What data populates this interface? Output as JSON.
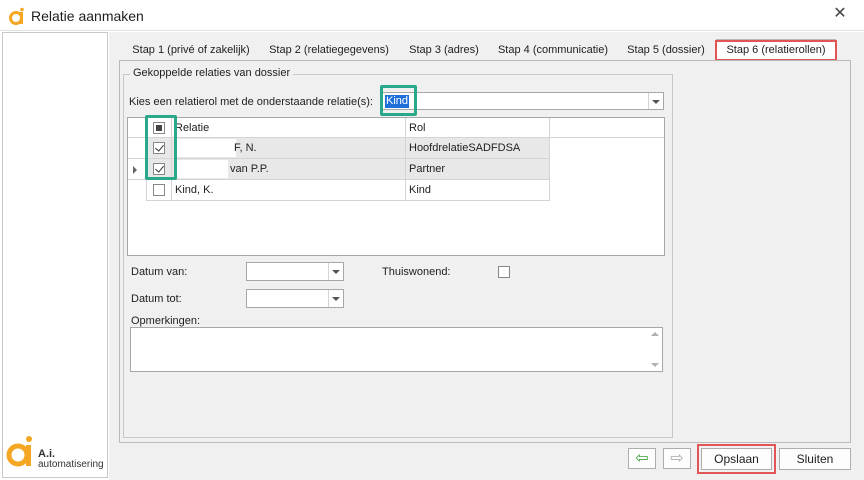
{
  "window": {
    "title": "Relatie aanmaken",
    "close_glyph": "✕"
  },
  "brand": {
    "logo_letter": "a",
    "name": "A.i.",
    "tagline": "automatisering",
    "accent": "#f5a623"
  },
  "tabs": [
    {
      "label": "Stap 1 (privé of zakelijk)"
    },
    {
      "label": "Stap 2 (relatiegegevens)"
    },
    {
      "label": "Stap 3 (adres)"
    },
    {
      "label": "Stap 4 (communicatie)"
    },
    {
      "label": "Stap 5 (dossier)"
    },
    {
      "label": "Stap 6 (relatierollen)",
      "active": true
    }
  ],
  "group": {
    "title": "Gekoppelde relaties van dossier",
    "role_label": "Kies een relatierol met de onderstaande relatie(s):",
    "role_value": "Kind"
  },
  "grid": {
    "columns": [
      "Relatie",
      "Rol"
    ],
    "rows": [
      {
        "checked": true,
        "relatie": "F, N.",
        "rol": "HoofdrelatieSADFDSA"
      },
      {
        "checked": true,
        "current": true,
        "relatie": "van P.P.",
        "rol": "Partner"
      },
      {
        "checked": false,
        "relatie": "Kind, K.",
        "rol": "Kind"
      }
    ]
  },
  "form": {
    "datum_van_label": "Datum van:",
    "datum_van_value": "",
    "datum_tot_label": "Datum tot:",
    "datum_tot_value": "",
    "thuiswonend_label": "Thuiswonend:",
    "thuiswonend_checked": false,
    "opmerkingen_label": "Opmerkingen:",
    "opmerkingen_value": ""
  },
  "footer": {
    "back_glyph": "⇦",
    "next_glyph": "⇨",
    "save_label": "Opslaan",
    "close_label": "Sluiten"
  },
  "colors": {
    "highlight_green": "#2aa88a",
    "highlight_red": "#e05555",
    "selection_blue": "#1e6fd9"
  }
}
